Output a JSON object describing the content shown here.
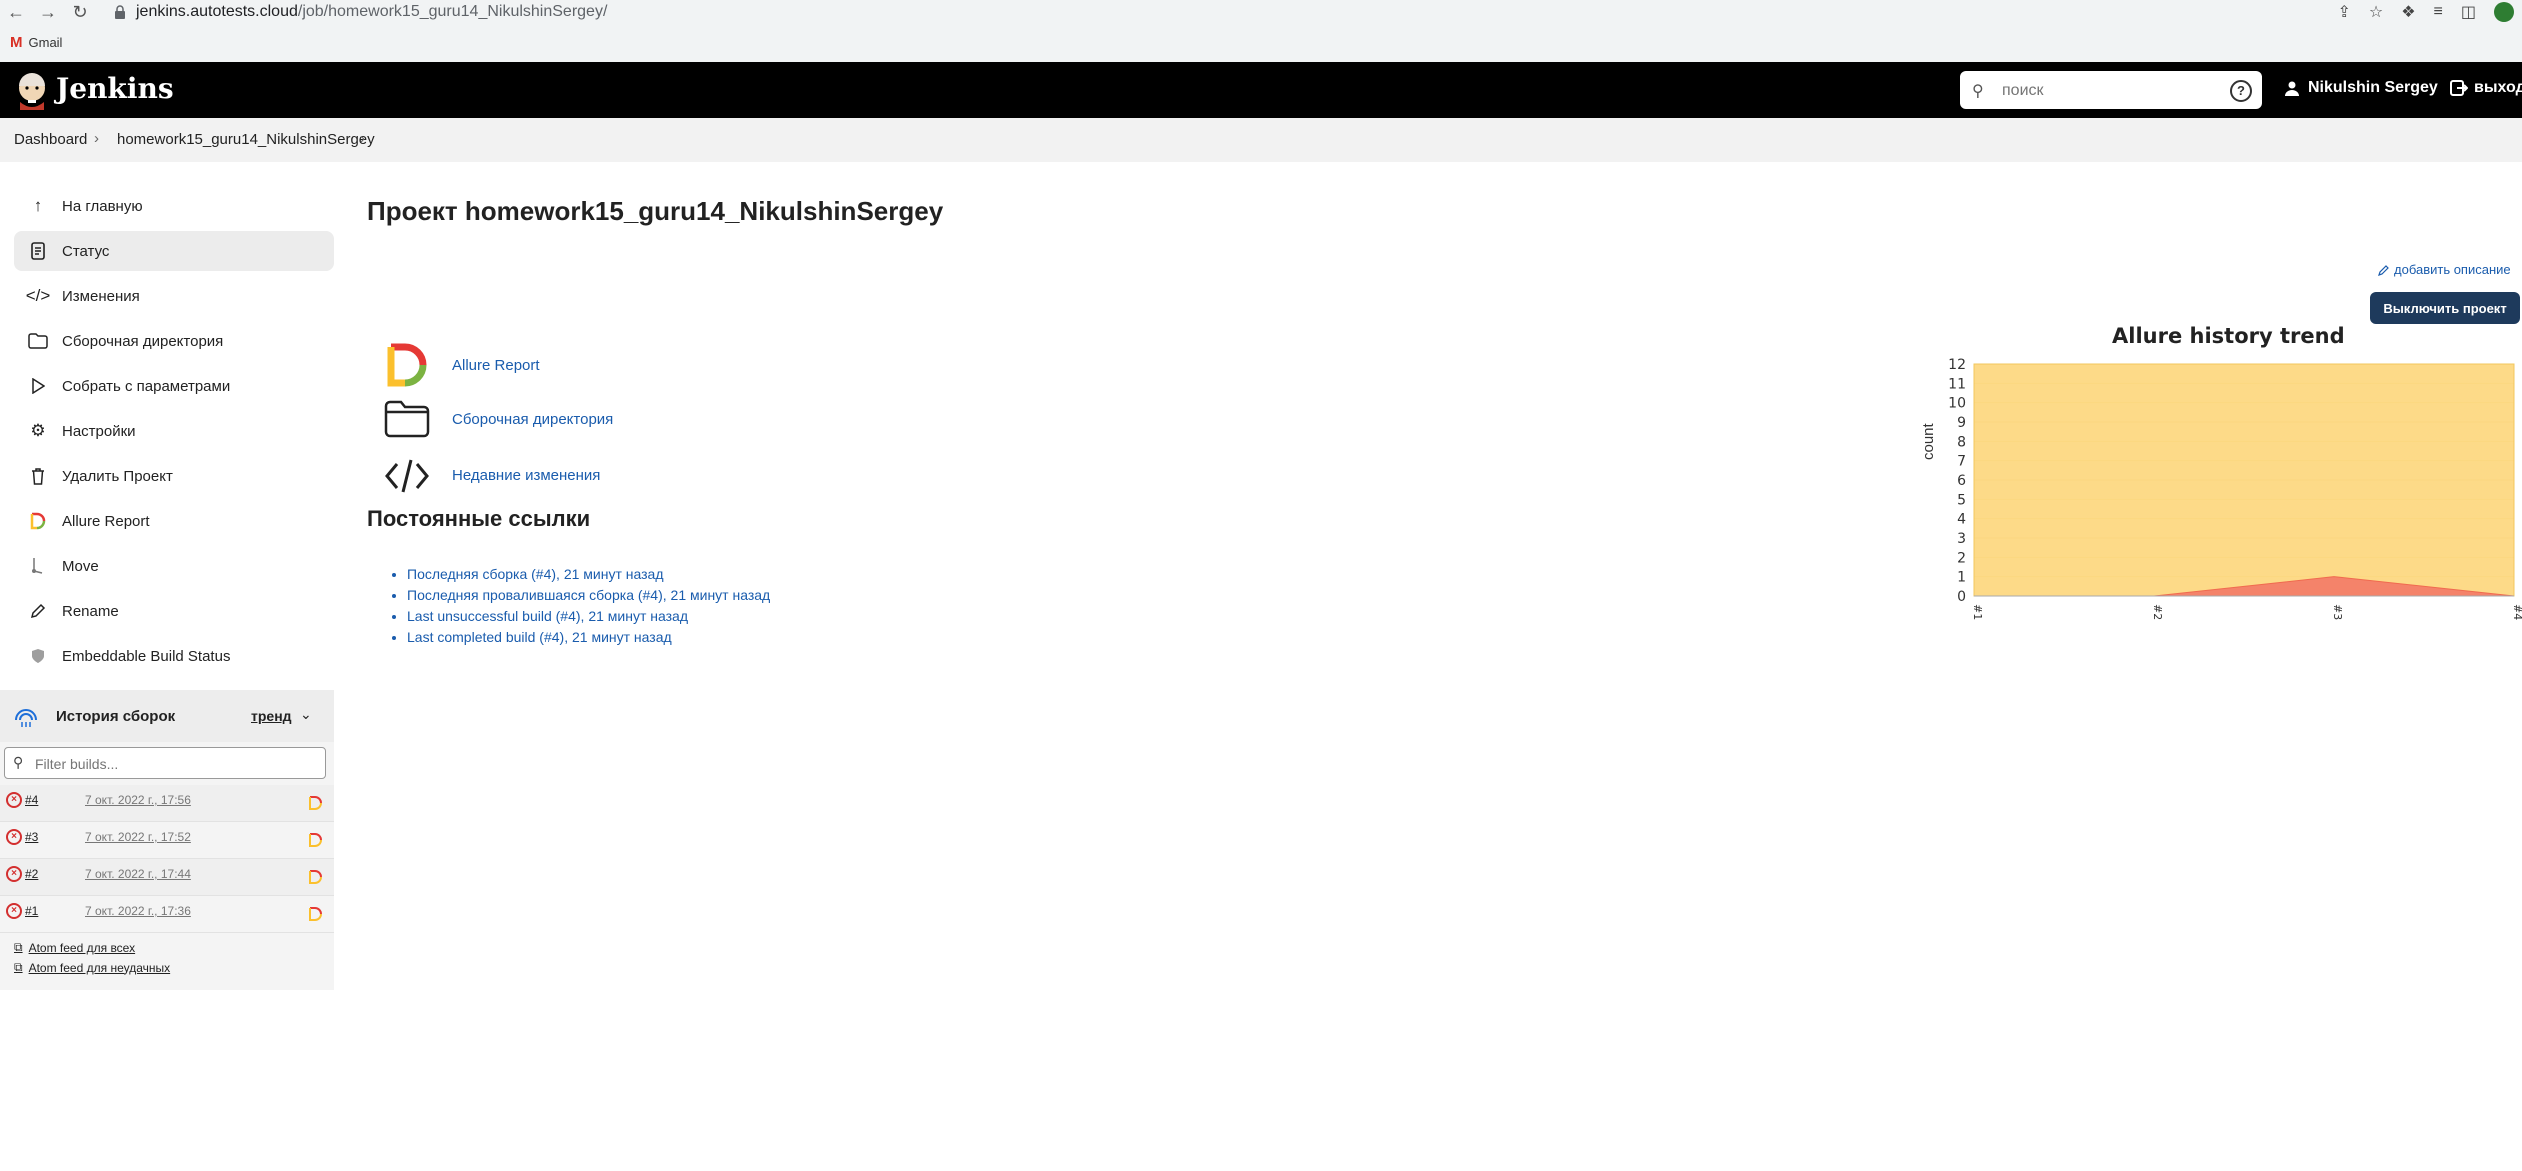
{
  "browser": {
    "url_host": "jenkins.autotests.cloud",
    "url_path": "/job/homework15_guru14_NikulshinSergey/",
    "bookmark": "Gmail"
  },
  "header": {
    "brand": "Jenkins",
    "search_placeholder": "поиск",
    "user_name": "Nikulshin Sergey",
    "logout_label": "выход"
  },
  "breadcrumb": {
    "items": [
      "Dashboard",
      "homework15_guru14_NikulshinSergey"
    ]
  },
  "sidebar": {
    "items": [
      {
        "label": "На главную",
        "icon": "arrow-up-icon"
      },
      {
        "label": "Статус",
        "icon": "document-icon"
      },
      {
        "label": "Изменения",
        "icon": "code-icon"
      },
      {
        "label": "Сборочная директория",
        "icon": "folder-icon"
      },
      {
        "label": "Собрать с параметрами",
        "icon": "play-icon"
      },
      {
        "label": "Настройки",
        "icon": "gear-icon"
      },
      {
        "label": "Удалить Проект",
        "icon": "trash-icon"
      },
      {
        "label": "Allure Report",
        "icon": "allure-icon"
      },
      {
        "label": "Move",
        "icon": "move-icon"
      },
      {
        "label": "Rename",
        "icon": "pencil-icon"
      },
      {
        "label": "Embeddable Build Status",
        "icon": "badge-icon"
      }
    ]
  },
  "build_history": {
    "title": "История сборок",
    "trend_label": "тренд",
    "filter_placeholder": "Filter builds...",
    "builds": [
      {
        "number": "#4",
        "date": "7 окт. 2022 г., 17:56"
      },
      {
        "number": "#3",
        "date": "7 окт. 2022 г., 17:52"
      },
      {
        "number": "#2",
        "date": "7 окт. 2022 г., 17:44"
      },
      {
        "number": "#1",
        "date": "7 окт. 2022 г., 17:36"
      }
    ],
    "feeds": [
      "Atom feed для всех",
      "Atom feed для неудачных"
    ]
  },
  "main": {
    "title": "Проект homework15_guru14_NikulshinSergey",
    "add_description": "добавить описание",
    "disable_button": "Выключить проект",
    "links": [
      "Allure Report",
      "Сборочная директория",
      "Недавние изменения"
    ],
    "permalinks_title": "Постоянные ссылки",
    "permalinks": [
      "Последняя сборка (#4), 21 минут назад",
      "Последняя провалившаяся сборка (#4), 21 минут назад",
      "Last unsuccessful build (#4), 21 минут назад",
      "Last completed build (#4), 21 минут назад"
    ]
  },
  "colors": {
    "header_bg": "#000000",
    "link": "#1a5cad",
    "button_bg": "#1e3a5c",
    "chart_passed": "#fdd882",
    "chart_failed": "#f4836a",
    "failed_status": "#d32f2f"
  },
  "chart_data": {
    "type": "area",
    "title": "Allure history trend",
    "xlabel": "",
    "ylabel": "count",
    "categories": [
      "#1",
      "#2",
      "#3",
      "#4"
    ],
    "ylim": [
      0,
      12
    ],
    "yticks": [
      0,
      1,
      2,
      3,
      4,
      5,
      6,
      7,
      8,
      9,
      10,
      11,
      12
    ],
    "series": [
      {
        "values": [
          12,
          12,
          12,
          12
        ]
      },
      {
        "values": [
          0,
          0,
          1,
          0
        ]
      }
    ]
  }
}
